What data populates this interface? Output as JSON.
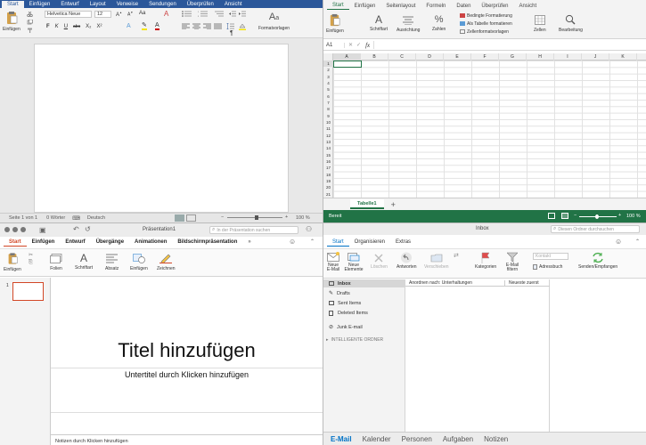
{
  "word": {
    "tabs": [
      "Start",
      "Einfügen",
      "Entwurf",
      "Layout",
      "Verweise",
      "Sendungen",
      "Überprüfen",
      "Ansicht"
    ],
    "paste_label": "Einfügen",
    "font_name": "Helvetica Neue",
    "font_size": "12",
    "format_buttons": [
      "F",
      "K",
      "U",
      "abc",
      "X₂",
      "X²"
    ],
    "styles_label": "Formatvorlagen",
    "status": {
      "page": "Seite 1 von 1",
      "words": "0 Wörter",
      "language": "Deutsch",
      "zoom": "100 %"
    }
  },
  "excel": {
    "tabs": [
      "Start",
      "Einfügen",
      "Seitenlayout",
      "Formeln",
      "Daten",
      "Überprüfen",
      "Ansicht"
    ],
    "paste_label": "Einfügen",
    "font_label": "Schriftart",
    "align_label": "Ausrichtung",
    "number_label": "Zahlen",
    "style_items": [
      "Bedingte Formatierung",
      "Als Tabelle formatieren",
      "Zellenformatvorlagen"
    ],
    "cells_label": "Zellen",
    "edit_label": "Bearbeitung",
    "name_box": "A1",
    "fx": "fx",
    "columns": [
      "A",
      "B",
      "C",
      "D",
      "E",
      "F",
      "G",
      "H",
      "I",
      "J",
      "K"
    ],
    "rows": [
      "1",
      "2",
      "3",
      "4",
      "5",
      "6",
      "7",
      "8",
      "9",
      "10",
      "11",
      "12",
      "13",
      "14",
      "15",
      "16",
      "17",
      "18",
      "19",
      "20",
      "21"
    ],
    "sheet_tab": "Tabelle1",
    "add_sheet": "+",
    "status": {
      "ready": "Bereit",
      "zoom": "100 %"
    }
  },
  "ppt": {
    "title": "Präsentation1",
    "search_placeholder": "In der Präsentation suchen",
    "tabs": [
      "Start",
      "Einfügen",
      "Entwurf",
      "Übergänge",
      "Animationen",
      "Bildschirmpräsentation"
    ],
    "more": "»",
    "ribbon": [
      "Einfügen",
      "Folien",
      "Schriftart",
      "Absatz",
      "Einfügen",
      "Zeichnen"
    ],
    "slide_number": "1",
    "slide_title": "Titel hinzufügen",
    "slide_subtitle": "Untertitel durch Klicken hinzufügen",
    "notes": "Notizen durch Klicken hinzufügen"
  },
  "outlook": {
    "title": "Inbox",
    "search_placeholder": "Diesen Ordner durchsuchen",
    "tabs": [
      "Start",
      "Organisieren",
      "Extras"
    ],
    "ribbon": [
      "Neue E-Mail",
      "Neue Elemente",
      "Löschen",
      "Antworten",
      "Verschieben",
      "Kategorien",
      "E-Mail filtern",
      "Adressbuch",
      "Senden/Empfangen"
    ],
    "contact_placeholder": "Kontakt",
    "folders": [
      "Inbox",
      "Drafts",
      "Sent Items",
      "Deleted Items",
      "Junk E-mail"
    ],
    "group_header": "INTELLIGENTE ORDNER",
    "sort_label": "Anordnen nach: Unterhaltungen",
    "sort_order": "Neueste zuerst",
    "nav": [
      "E-Mail",
      "Kalender",
      "Personen",
      "Aufgaben",
      "Notizen"
    ]
  },
  "colors": {
    "word": "#2b579a",
    "excel": "#217346",
    "ppt": "#d24726",
    "outlook": "#0072c6"
  }
}
